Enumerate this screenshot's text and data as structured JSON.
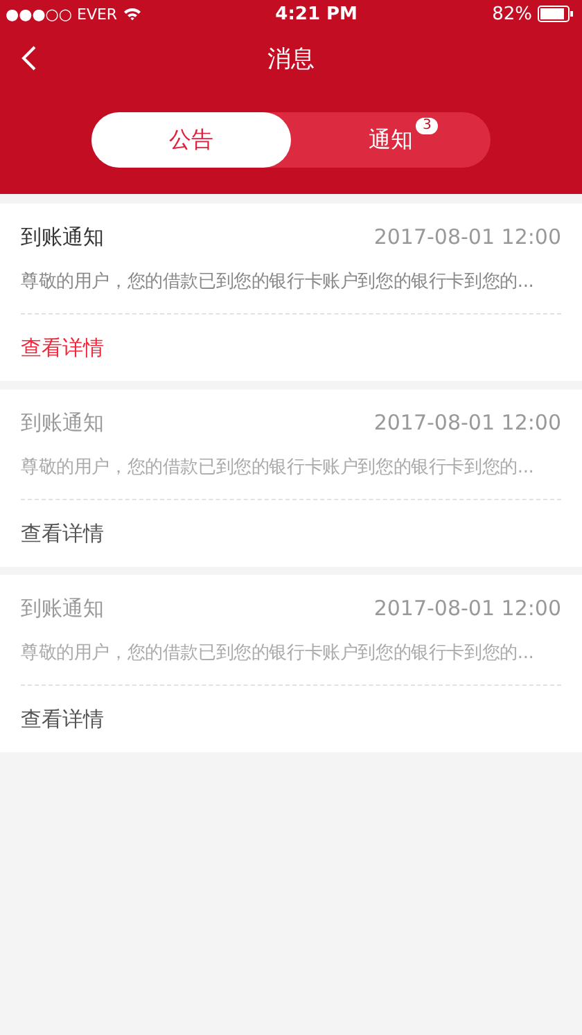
{
  "status_bar": {
    "carrier": "●●●○○ EVER",
    "time": "4:21 PM",
    "battery": "82%"
  },
  "nav": {
    "title": "消息"
  },
  "tabs": [
    {
      "label": "公告",
      "selected": true
    },
    {
      "label": "通知",
      "selected": false,
      "badge": "3"
    }
  ],
  "messages": [
    {
      "title": "到账通知",
      "time": "2017-08-01 12:00",
      "body": "尊敬的用户，您的借款已到您的银行卡账户到您的银行卡到您的...",
      "link": "查看详情",
      "unread": true
    },
    {
      "title": "到账通知",
      "time": "2017-08-01 12:00",
      "body": "尊敬的用户，您的借款已到您的银行卡账户到您的银行卡到您的...",
      "link": "查看详情",
      "unread": false
    },
    {
      "title": "到账通知",
      "time": "2017-08-01 12:00",
      "body": "尊敬的用户，您的借款已到您的银行卡账户到您的银行卡到您的...",
      "link": "查看详情",
      "unread": false
    }
  ]
}
